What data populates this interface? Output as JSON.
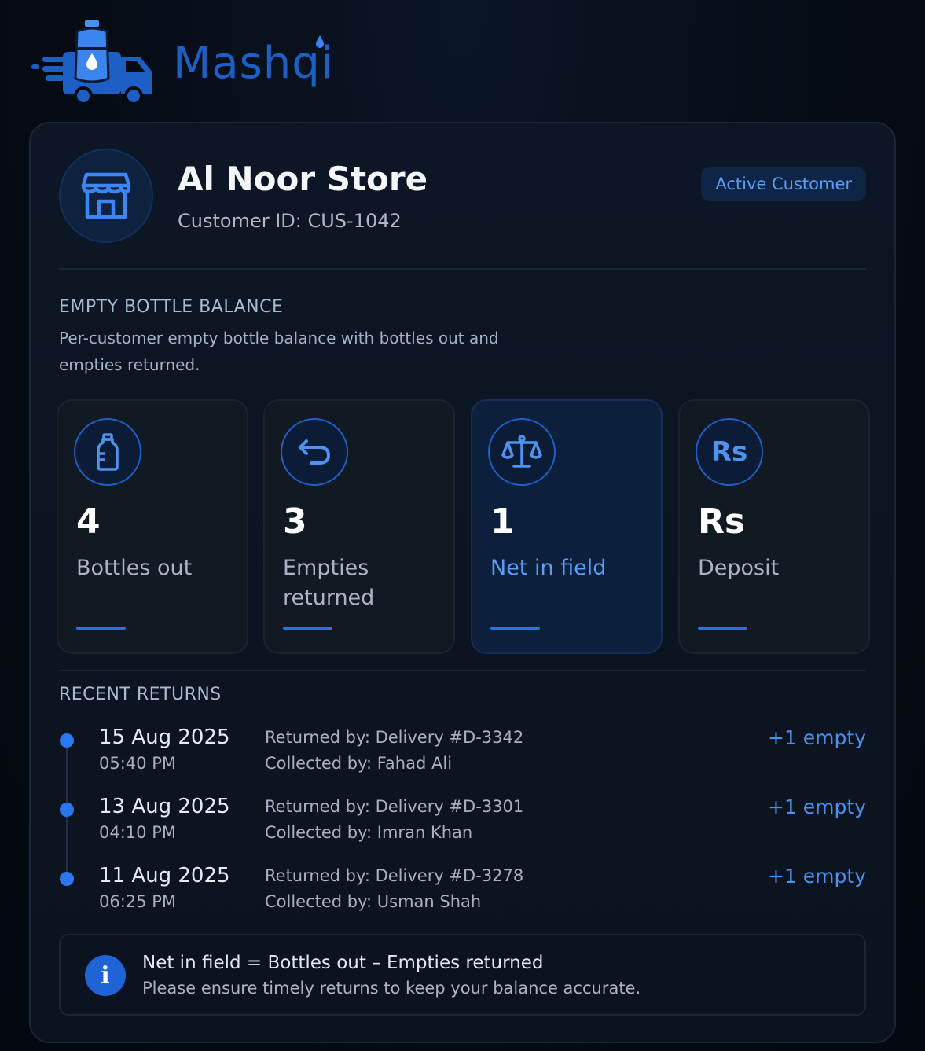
{
  "brand": {
    "name": "Mashqi",
    "logo_icon": "water-delivery-truck-icon"
  },
  "customer": {
    "name": "Al Noor Store",
    "id_text": "Customer ID: CUS-1042",
    "status": "Active Customer",
    "avatar_icon": "store-icon"
  },
  "balance": {
    "title": "EMPTY BOTTLE BALANCE",
    "description": "Per-customer empty bottle balance with bottles out and empties returned.",
    "stats": [
      {
        "value": "4",
        "label": "Bottles out",
        "icon": "bottle-icon"
      },
      {
        "value": "3",
        "label": "Empties returned",
        "icon": "return-arrow-icon"
      },
      {
        "value": "1",
        "label": "Net in field",
        "icon": "scale-icon"
      },
      {
        "value": "Rs",
        "label": "Deposit",
        "icon": "rupee-icon",
        "icon_text": "Rs"
      }
    ]
  },
  "returns": {
    "title": "RECENT RETURNS",
    "items": [
      {
        "date": "15 Aug 2025",
        "time": "05:40 PM",
        "returned_by": "Returned by: Delivery #D-3342",
        "collected_by": "Collected by: Fahad Ali",
        "change": "+1 empty"
      },
      {
        "date": "13 Aug 2025",
        "time": "04:10 PM",
        "returned_by": "Returned by: Delivery #D-3301",
        "collected_by": "Collected by: Imran Khan",
        "change": "+1 empty"
      },
      {
        "date": "11 Aug 2025",
        "time": "06:25 PM",
        "returned_by": "Returned by: Delivery #D-3278",
        "collected_by": "Collected by: Usman Shah",
        "change": "+1 empty"
      }
    ]
  },
  "info": {
    "formula": "Net in field = Bottles out – Empties returned",
    "note": "Please ensure timely returns to keep your balance accurate.",
    "icon": "info-icon",
    "icon_text": "i"
  },
  "colors": {
    "accent": "#2a78f0",
    "background": "#060b14",
    "card": "#0d1624",
    "brand": "#1d5fc4"
  }
}
